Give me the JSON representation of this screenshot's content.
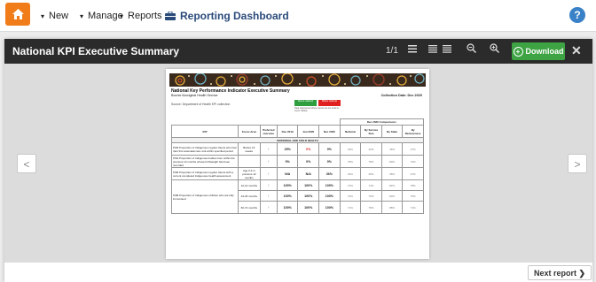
{
  "topnav": {
    "home_icon": "home-icon",
    "items": [
      {
        "label": "New",
        "caret": "▾"
      },
      {
        "label": "Manage",
        "caret": "▾"
      },
      {
        "label": "Reports",
        "caret": "▾"
      }
    ],
    "dashboard_label": "Reporting Dashboard",
    "dashboard_icon": "dashboard-icon",
    "help_label": "?",
    "accent": "#f07d1a"
  },
  "modal": {
    "title": "National KPI Executive Summary",
    "page_count": "1/1",
    "download_label": "Download",
    "download_color": "#3da343",
    "close_label": "✕",
    "prev_label": "<",
    "next_arrow_label": ">",
    "next_report_label": "Next report ❯"
  },
  "document": {
    "title": "National Key Performance Indicator Executive Summary",
    "subtitle": "Bourke Aboriginal Health Service",
    "source": "Source: Department of Health KPI collection",
    "collection_date": "Collection Date: Dec 2020",
    "legend": [
      {
        "label": "Above national",
        "color": "#2e9e3e"
      },
      {
        "label": "Below national",
        "color": "#e02020"
      }
    ],
    "legend_note": "Data suppressed where counts are too small to report reliably.",
    "comparisons_header": "Dec 2020 Comparisons",
    "columns": [
      "KPI",
      "Focus Area",
      "Preferred outcome",
      "Dec 2019",
      "Jun 2020",
      "Dec 2020",
      "National",
      "By Service Size",
      "By State",
      "By Remoteness"
    ],
    "section": "MATERNAL AND CHILD HEALTH",
    "rows": [
      {
        "kpi": "PI03 Proportion of Indigenous regular clients who had their first antenatal care visit within specified period",
        "focus": "Before 13 weeks",
        "arrow": "↑",
        "v1": "25%",
        "v2": "0%",
        "v3": "0%",
        "n": "43%",
        "s": "43%",
        "st": "46%",
        "r": "47%",
        "v2red": true
      },
      {
        "kpi": "PI04 Proportion of Indigenous babies born within the previous 12 months whose birthweight has been recorded",
        "focus": "",
        "arrow": "↑",
        "v1": "0%",
        "v2": "0%",
        "v3": "0%",
        "n": "78%",
        "s": "78%",
        "st": "80%",
        "r": "74%",
        "v2red": false
      },
      {
        "kpi": "PI06 Proportion of Indigenous regular clients with a current completed Indigenous health assessment",
        "focus": "Age 0-4 in previous 12 months",
        "arrow": "↑",
        "v1": "N/A",
        "v2": "N/A",
        "v3": "36%",
        "n": "33%",
        "st": "38%",
        "s": "35%",
        "r": "37%",
        "v2red": false
      },
      {
        "kpi": "",
        "focus": "12-14 months",
        "arrow": "↑",
        "v1": "100%",
        "v2": "100%",
        "v3": "100%",
        "n": "74%",
        "s": "74%",
        "st": "82%",
        "r": "78%",
        "v2red": false
      },
      {
        "kpi": "PI08 Proportion of Indigenous children who are fully immunised",
        "focus": "24-36 months",
        "arrow": "↑",
        "v1": "100%",
        "v2": "100%",
        "v3": "100%",
        "n": "76%",
        "s": "75%",
        "st": "80%",
        "r": "75%",
        "v2red": false
      },
      {
        "kpi": "",
        "focus": "60-72 months",
        "arrow": "↑",
        "v1": "100%",
        "v2": "100%",
        "v3": "100%",
        "n": "71%",
        "s": "78%",
        "st": "88%",
        "r": "71%",
        "v2red": false
      }
    ]
  }
}
